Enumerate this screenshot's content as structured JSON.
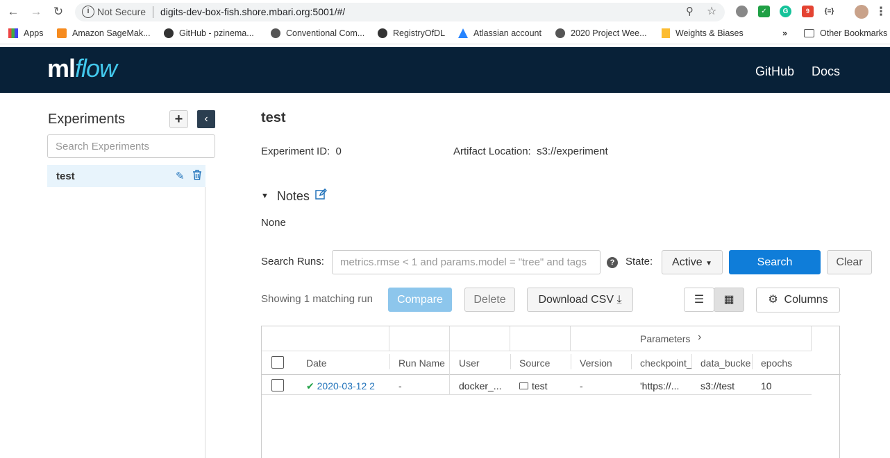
{
  "browser": {
    "secure_label": "Not Secure",
    "url": "digits-dev-box-fish.shore.mbari.org:5001/#/",
    "ext_badge": "9",
    "ext_json": "{=}",
    "bookmarks": [
      {
        "label": "Apps"
      },
      {
        "label": "Amazon SageMak..."
      },
      {
        "label": "GitHub - pzinema..."
      },
      {
        "label": "Conventional Com..."
      },
      {
        "label": "RegistryOfDL"
      },
      {
        "label": "Atlassian account"
      },
      {
        "label": "2020 Project Wee..."
      },
      {
        "label": "Weights & Biases"
      }
    ],
    "more": "»",
    "other_bookmarks": "Other Bookmarks"
  },
  "header": {
    "logo_ml": "ml",
    "logo_flow": "flow",
    "links": [
      "GitHub",
      "Docs"
    ]
  },
  "sidebar": {
    "title": "Experiments",
    "add": "+",
    "collapse": "‹",
    "search_placeholder": "Search Experiments",
    "experiments": [
      {
        "name": "test"
      }
    ]
  },
  "experiment": {
    "name": "test",
    "id_label": "Experiment ID:",
    "id_value": "0",
    "artifact_label": "Artifact Location:",
    "artifact_value": "s3://experiment",
    "notes_label": "Notes",
    "notes_body": "None"
  },
  "search": {
    "label": "Search Runs:",
    "placeholder": "metrics.rmse < 1 and params.model = \"tree\" and tags",
    "help": "?",
    "state_label": "State:",
    "state_value": "Active",
    "search_button": "Search",
    "clear_button": "Clear"
  },
  "runs_toolbar": {
    "showing": "Showing 1 matching run",
    "compare": "Compare",
    "delete": "Delete",
    "download": "Download CSV",
    "columns": "Columns"
  },
  "table": {
    "group_header": "Parameters",
    "group_arrow": "›",
    "columns": [
      "Date",
      "Run Name",
      "User",
      "Source",
      "Version",
      "checkpoint_",
      "data_bucke",
      "epochs"
    ],
    "rows": [
      {
        "date": "2020-03-12 2",
        "run_name": "-",
        "user": "docker_...",
        "source": "test",
        "version": "-",
        "checkpoint": "'https://...",
        "data_bucket": "s3://test",
        "epochs": "10"
      }
    ]
  }
}
